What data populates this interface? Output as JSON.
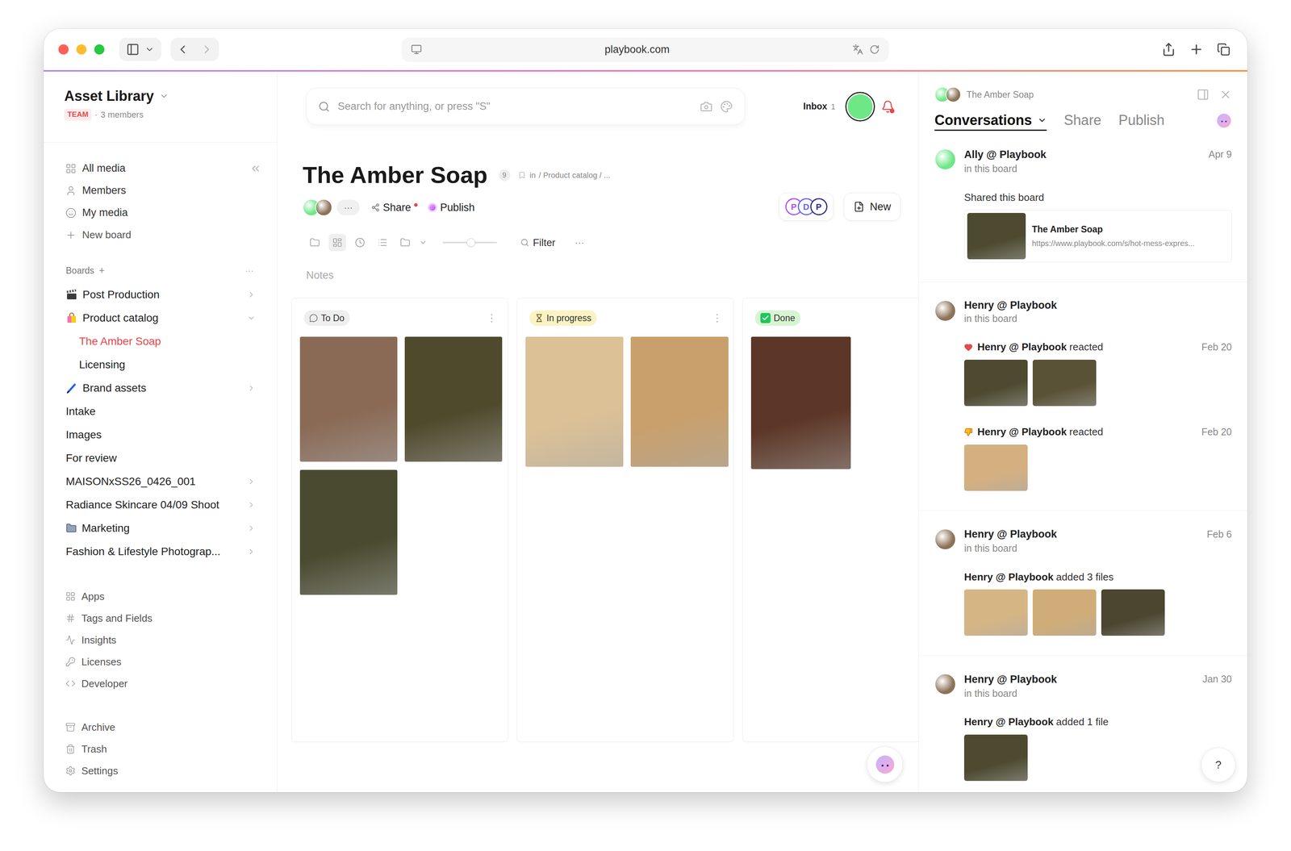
{
  "browser": {
    "url": "playbook.com"
  },
  "sidebar": {
    "workspace": "Asset Library",
    "team_badge": "TEAM",
    "members_separator": "·",
    "members": "3 members",
    "nav": [
      {
        "label": "All media",
        "kind": "grid"
      },
      {
        "label": "Members",
        "kind": "user"
      },
      {
        "label": "My media",
        "kind": "smile"
      },
      {
        "label": "New board",
        "kind": "plus"
      }
    ],
    "boards_title": "Boards",
    "boards_add": "+",
    "boards_more": "···",
    "boards": [
      {
        "label": "Post Production",
        "kind": "clapper",
        "has_children": true,
        "expanded": false,
        "selected": false,
        "children": []
      },
      {
        "label": "Product catalog",
        "kind": "bag",
        "has_children": true,
        "expanded": true,
        "selected": false,
        "children": [
          {
            "label": "The Amber Soap",
            "selected": true
          },
          {
            "label": "Licensing",
            "selected": false
          }
        ]
      },
      {
        "label": "Brand assets",
        "kind": "pen",
        "has_children": true,
        "expanded": false,
        "selected": false,
        "children": []
      },
      {
        "label": "Intake",
        "kind": "plain",
        "has_children": false,
        "expanded": false,
        "selected": false,
        "children": []
      },
      {
        "label": "Images",
        "kind": "plain",
        "has_children": false,
        "expanded": false,
        "selected": false,
        "children": []
      },
      {
        "label": "For review",
        "kind": "plain",
        "has_children": false,
        "expanded": false,
        "selected": false,
        "children": []
      },
      {
        "label": "MAISONxSS26_0426_001",
        "kind": "plain",
        "has_children": true,
        "expanded": false,
        "selected": false,
        "children": []
      },
      {
        "label": "Radiance Skincare 04/09 Shoot",
        "kind": "plain",
        "has_children": true,
        "expanded": false,
        "selected": false,
        "children": []
      },
      {
        "label": "Marketing",
        "kind": "folder",
        "has_children": true,
        "expanded": false,
        "selected": false,
        "children": []
      },
      {
        "label": "Fashion & Lifestyle Photograp...",
        "kind": "plain",
        "has_children": true,
        "expanded": false,
        "selected": false,
        "children": []
      }
    ],
    "tools": [
      {
        "label": "Apps",
        "kind": "apps"
      },
      {
        "label": "Tags and Fields",
        "kind": "hash"
      },
      {
        "label": "Insights",
        "kind": "chart"
      },
      {
        "label": "Licenses",
        "kind": "license"
      },
      {
        "label": "Developer",
        "kind": "code"
      }
    ],
    "system": [
      {
        "label": "Archive",
        "kind": "archive"
      },
      {
        "label": "Trash",
        "kind": "trash"
      },
      {
        "label": "Settings",
        "kind": "settings"
      }
    ]
  },
  "search": {
    "placeholder": "Search for anything, or press \"S\""
  },
  "inbox": {
    "label": "Inbox",
    "count": "1",
    "notification": true
  },
  "user": {
    "color": "#6ee787"
  },
  "board": {
    "title": "The Amber Soap",
    "count": "9",
    "location": "in",
    "path": "/ Product catalog / ...",
    "collaborators": [
      {
        "color": "#6ee787"
      },
      {
        "color": "#8c7258"
      }
    ],
    "more": "···",
    "share": "Share",
    "share_alert": true,
    "publish": "Publish",
    "apps": [
      {
        "letter": "P",
        "color": "#a855f7"
      },
      {
        "letter": "D",
        "color": "#6366f1"
      },
      {
        "letter": "P",
        "color": "#312e81"
      }
    ],
    "new": "New"
  },
  "view_toolbar": {
    "views": [
      {
        "kind": "folder",
        "selected": false
      },
      {
        "kind": "board",
        "selected": true
      },
      {
        "kind": "timeline",
        "selected": false
      },
      {
        "kind": "list",
        "selected": false
      },
      {
        "kind": "folders",
        "selected": false
      }
    ],
    "zoom": 0.52,
    "filter": "Filter",
    "more": "···"
  },
  "notes_placeholder": "Notes",
  "columns": [
    {
      "title": "To Do",
      "kind": "todo",
      "color": "#efefef",
      "menu": "⋮",
      "cards": [
        {
          "color": "#8a6a55"
        },
        {
          "color": "#4f4a2c"
        },
        {
          "color": "#4a4a30"
        }
      ]
    },
    {
      "title": "In progress",
      "kind": "progress",
      "color": "#fbf3c4",
      "menu": "⋮",
      "cards": [
        {
          "color": "#dcc196"
        },
        {
          "color": "#c9a06c"
        }
      ]
    },
    {
      "title": "Done",
      "kind": "done",
      "color": "#d7f5d3",
      "cards": [
        {
          "color": "#5c3626"
        }
      ]
    }
  ],
  "panel": {
    "title": "The Amber Soap",
    "tabs": [
      {
        "label": "Conversations",
        "selected": true
      },
      {
        "label": "Share",
        "selected": false
      },
      {
        "label": "Publish",
        "selected": false
      }
    ],
    "feed": [
      {
        "author": "Ally @ Playbook",
        "context": "in this board",
        "date": "Apr 9",
        "avatar_color": "#6ee787",
        "events": [
          {
            "kind": "shared",
            "text": "Shared this board",
            "link": {
              "title": "The Amber Soap",
              "url": "https://www.playbook.com/s/hot-mess-expres...",
              "color": "#4d4a30"
            }
          }
        ]
      },
      {
        "author": "Henry @ Playbook",
        "context": "in this board",
        "avatar_color": "#8c7258",
        "events": [
          {
            "kind": "heart",
            "actor": "Henry @ Playbook",
            "action": "reacted",
            "date": "Feb 20",
            "images": [
              {
                "color": "#4d4a30"
              },
              {
                "color": "#5a5236"
              }
            ]
          },
          {
            "kind": "thumbsdown",
            "actor": "Henry @ Playbook",
            "action": "reacted",
            "date": "Feb 20",
            "images": [
              {
                "color": "#d4b080"
              }
            ]
          }
        ]
      },
      {
        "author": "Henry @ Playbook",
        "context": "in this board",
        "date": "Feb 6",
        "avatar_color": "#8c7258",
        "events": [
          {
            "kind": "added",
            "actor": "Henry @ Playbook",
            "action": "added 3 files",
            "images": [
              {
                "color": "#d6b585"
              },
              {
                "color": "#d0ad78"
              },
              {
                "color": "#4a4630"
              }
            ]
          }
        ]
      },
      {
        "author": "Henry @ Playbook",
        "context": "in this board",
        "date": "Jan 30",
        "avatar_color": "#8c7258",
        "events": [
          {
            "kind": "added",
            "actor": "Henry @ Playbook",
            "action": "added 1 file",
            "images": [
              {
                "color": "#4d4a30"
              }
            ]
          }
        ]
      }
    ],
    "help": "?"
  }
}
